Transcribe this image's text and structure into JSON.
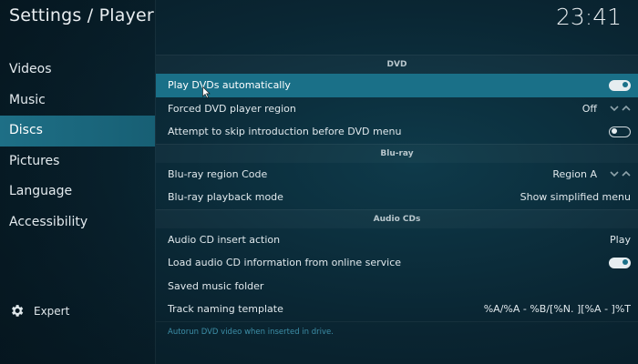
{
  "header": {
    "title": "Settings / Player",
    "clock": "23:41"
  },
  "sidebar": {
    "items": [
      {
        "label": "Videos",
        "active": false
      },
      {
        "label": "Music",
        "active": false
      },
      {
        "label": "Discs",
        "active": true
      },
      {
        "label": "Pictures",
        "active": false
      },
      {
        "label": "Language",
        "active": false
      },
      {
        "label": "Accessibility",
        "active": false
      }
    ],
    "expert_label": "Expert"
  },
  "sections": {
    "dvd": {
      "header": "DVD",
      "rows": [
        {
          "label": "Play DVDs automatically",
          "control": "toggle",
          "state": "on"
        },
        {
          "label": "Forced DVD player region",
          "control": "spinner",
          "value": "Off"
        },
        {
          "label": "Attempt to skip introduction before DVD menu",
          "control": "toggle",
          "state": "off"
        }
      ]
    },
    "bluray": {
      "header": "Blu-ray",
      "rows": [
        {
          "label": "Blu-ray region Code",
          "control": "spinner",
          "value": "Region A"
        },
        {
          "label": "Blu-ray playback mode",
          "control": "value",
          "value": "Show simplified menu"
        }
      ]
    },
    "audiocd": {
      "header": "Audio CDs",
      "rows": [
        {
          "label": "Audio CD insert action",
          "control": "value",
          "value": "Play"
        },
        {
          "label": "Load audio CD information from online service",
          "control": "toggle",
          "state": "on"
        },
        {
          "label": "Saved music folder",
          "control": "none"
        },
        {
          "label": "Track naming template",
          "control": "value",
          "value": "%A/%A - %B/[%N. ][%A - ]%T"
        }
      ]
    }
  },
  "help_text": "Autorun DVD video when inserted in drive.",
  "colors": {
    "accent": "#1a7088",
    "background": "#0a2633",
    "help_text": "#3d8fa8"
  }
}
